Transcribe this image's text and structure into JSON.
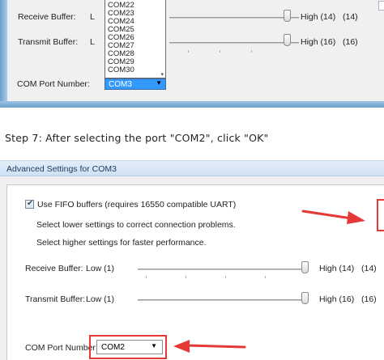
{
  "top_dialog": {
    "receive_label": "Receive Buffer:",
    "receive_low_prefix": "L",
    "receive_high": "High (14)",
    "receive_value": "(14)",
    "transmit_label": "Transmit Buffer:",
    "transmit_low_prefix": "L",
    "transmit_high": "High (16)",
    "transmit_value": "(16)",
    "com_port_label": "COM Port Number:",
    "com_port_value": "COM3",
    "dropdown_options": [
      "COM22",
      "COM23",
      "COM24",
      "COM25",
      "COM26",
      "COM27",
      "COM28",
      "COM29",
      "COM30"
    ]
  },
  "caption": "Step 7: After selecting the port \"COM2\", click \"OK\"",
  "dialog": {
    "title": "Advanced Settings for COM3",
    "fifo_label": "Use FIFO buffers (requires 16550 compatible UART)",
    "fifo_checked": true,
    "hint_lower": "Select lower settings to correct connection problems.",
    "hint_higher": "Select higher settings for faster performance.",
    "receive_label": "Receive Buffer:",
    "receive_low": "Low (1)",
    "receive_high": "High (14)",
    "receive_value": "(14)",
    "receive_level": 1.0,
    "transmit_label": "Transmit Buffer:",
    "transmit_low": "Low (1)",
    "transmit_high": "High (16)",
    "transmit_value": "(16)",
    "transmit_level": 1.0,
    "com_port_label": "COM Port Number:",
    "com_port_value": "COM2"
  },
  "colors": {
    "highlight_red": "#e53935",
    "selection_blue": "#3399ff"
  }
}
